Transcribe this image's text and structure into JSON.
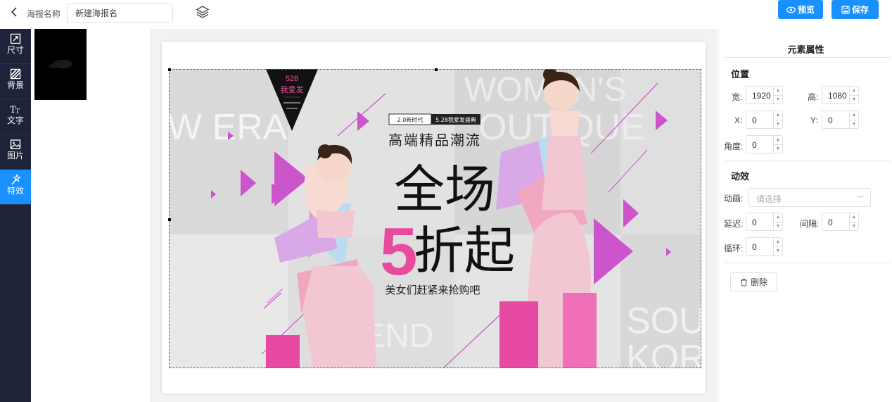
{
  "header": {
    "back_icon": "chevron-left-icon",
    "name_label": "海报名称",
    "name_value": "新建海报名",
    "layers_icon": "layers-icon",
    "preview_label": "预览",
    "save_label": "保存"
  },
  "sidebar": {
    "items": [
      {
        "label": "尺寸",
        "icon": "resize-icon"
      },
      {
        "label": "背景",
        "icon": "background-icon"
      },
      {
        "label": "文字",
        "icon": "text-icon"
      },
      {
        "label": "图片",
        "icon": "image-icon"
      },
      {
        "label": "特效",
        "icon": "effects-icon",
        "active": true
      }
    ]
  },
  "poster": {
    "badge_number": "528",
    "badge_text": "我爱发",
    "tag_left": "2.0新时代",
    "tag_right": "5.28我爱发盛典",
    "subtitle": "高端精品潮流",
    "headline_1": "全场",
    "headline_num": "5",
    "headline_2": "折起",
    "tagline": "美女们赶紧来抢购吧",
    "bg_words": [
      "W ERA",
      "WOMEN'S",
      "OUTIQUE",
      "SOUT",
      "KORE",
      "END"
    ],
    "accent_color": "#cc55cc",
    "pink_color": "#e94b9c"
  },
  "props": {
    "title": "元素属性",
    "position_title": "位置",
    "width_label": "宽:",
    "width_value": "1920",
    "height_label": "高:",
    "height_value": "1080",
    "x_label": "X:",
    "x_value": "0",
    "y_label": "Y:",
    "y_value": "0",
    "angle_label": "角度:",
    "angle_value": "0",
    "animation_title": "动效",
    "anim_label": "动画:",
    "anim_placeholder": "请选择",
    "delay_label": "延迟:",
    "delay_value": "0",
    "interval_label": "间隔:",
    "interval_value": "0",
    "loop_label": "循环:",
    "loop_value": "0",
    "delete_label": "删除"
  }
}
